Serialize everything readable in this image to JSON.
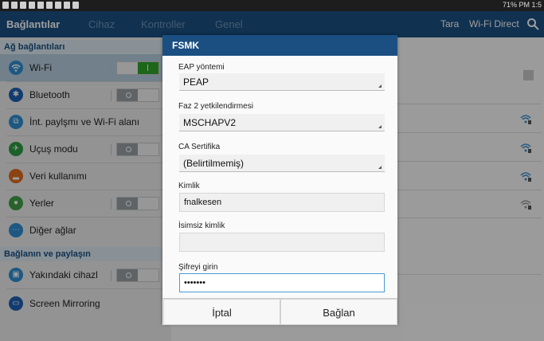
{
  "status_bar": {
    "right_text": "71% PM 1:5"
  },
  "top_bar": {
    "tabs": [
      {
        "label": "Bağlantılar",
        "active": true
      },
      {
        "label": "Cihaz"
      },
      {
        "label": "Kontroller"
      },
      {
        "label": "Genel"
      }
    ],
    "actions": [
      "Tara",
      "Wi-Fi Direct"
    ],
    "search_icon": "search-icon"
  },
  "sidebar": {
    "section1": "Ağ bağlantıları",
    "section2": "Bağlanın ve paylaşın",
    "items": [
      {
        "label": "Wi-Fi",
        "icon": "wifi-icon",
        "color": "#2f8fd4",
        "toggle": "on",
        "selected": true
      },
      {
        "label": "Bluetooth",
        "icon": "bluetooth-icon",
        "color": "#1e5fb3",
        "toggle": "off"
      },
      {
        "label": "İnt. paylşmı ve Wi-Fi alanı",
        "icon": "tethering-icon",
        "color": "#2f8fd4"
      },
      {
        "label": "Uçuş modu",
        "icon": "airplane-icon",
        "color": "#2e9d43",
        "toggle": "off"
      },
      {
        "label": "Veri kullanımı",
        "icon": "data-usage-icon",
        "color": "#e06d1e"
      },
      {
        "label": "Yerler",
        "icon": "location-icon",
        "color": "#43a047",
        "toggle": "off"
      },
      {
        "label": "Diğer ağlar",
        "icon": "more-networks-icon",
        "color": "#2f8fd4"
      },
      {
        "label": "Yakındaki cihazl",
        "icon": "nearby-devices-icon",
        "color": "#2f8fd4",
        "toggle": "off"
      },
      {
        "label": "Screen Mirroring",
        "icon": "screen-mirroring-icon",
        "color": "#1e5fb3"
      }
    ]
  },
  "dialog": {
    "title": "FSMK",
    "eap_label": "EAP yöntemi",
    "eap_value": "PEAP",
    "phase2_label": "Faz 2 yetkilendirmesi",
    "phase2_value": "MSCHAPV2",
    "ca_label": "CA Sertifika",
    "ca_value": "(Belirtilmemiş)",
    "identity_label": "Kimlik",
    "identity_value": "fnalkesen",
    "anon_label": "İsimsiz kimlik",
    "anon_value": "",
    "password_label": "Şifreyi girin",
    "password_value": "•••••••",
    "cancel_label": "İptal",
    "connect_label": "Bağlan"
  }
}
